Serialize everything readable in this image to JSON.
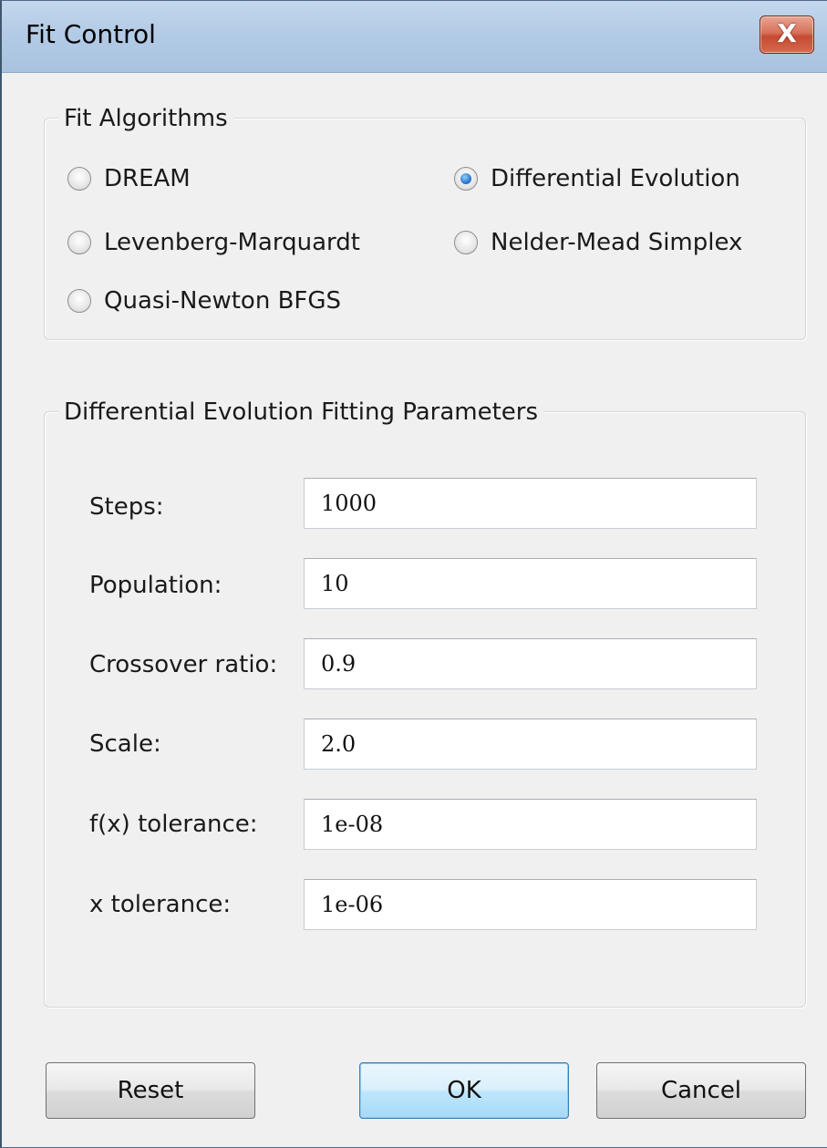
{
  "window": {
    "title": "Fit Control",
    "close_label": "X"
  },
  "algorithms": {
    "legend": "Fit Algorithms",
    "options": [
      {
        "label": "DREAM",
        "selected": false
      },
      {
        "label": "Differential Evolution",
        "selected": true
      },
      {
        "label": "Levenberg-Marquardt",
        "selected": false
      },
      {
        "label": "Nelder-Mead Simplex",
        "selected": false
      },
      {
        "label": "Quasi-Newton BFGS",
        "selected": false
      }
    ]
  },
  "params": {
    "legend": "Differential Evolution Fitting Parameters",
    "fields": [
      {
        "label": "Steps:",
        "value": "1000"
      },
      {
        "label": "Population:",
        "value": "10"
      },
      {
        "label": "Crossover ratio:",
        "value": "0.9"
      },
      {
        "label": "Scale:",
        "value": "2.0"
      },
      {
        "label": "f(x) tolerance:",
        "value": "1e-08"
      },
      {
        "label": "x tolerance:",
        "value": "1e-06"
      }
    ]
  },
  "buttons": {
    "reset": "Reset",
    "ok": "OK",
    "cancel": "Cancel"
  },
  "colors": {
    "titlebar": "#b3cbe6",
    "close_button": "#c64a33",
    "default_button": "#bee6fd",
    "radio_selected": "#2a7bd0"
  }
}
